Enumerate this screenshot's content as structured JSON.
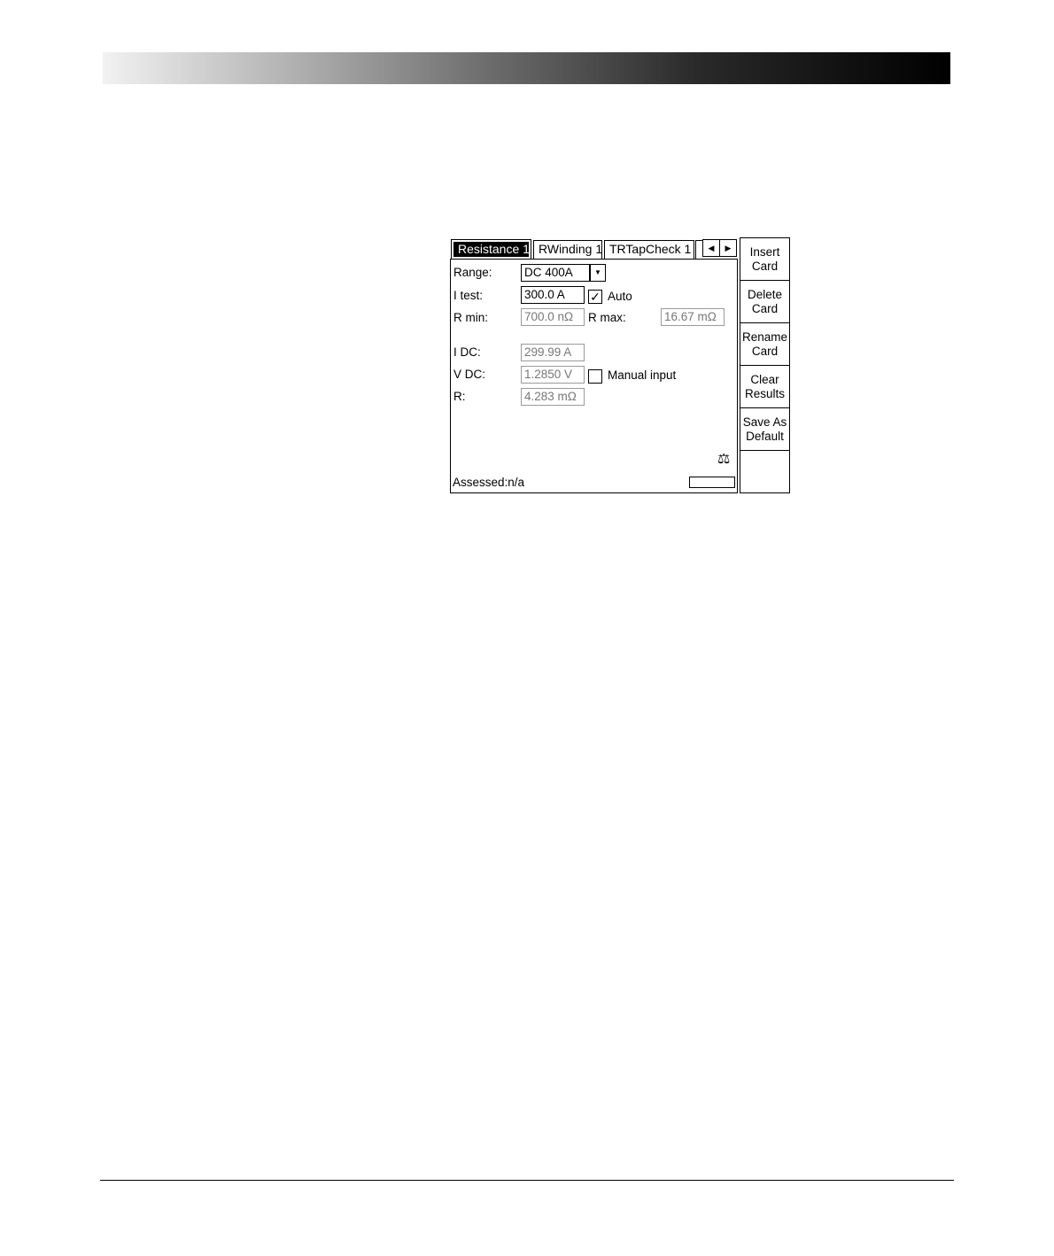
{
  "tabs": [
    {
      "label": "Resistance 1",
      "active": true
    },
    {
      "label": "RWinding 1",
      "active": false
    },
    {
      "label": "TRTapCheck 1",
      "active": false
    }
  ],
  "nav": {
    "prev_icon": "triangle-left-icon",
    "next_icon": "triangle-right-icon"
  },
  "form": {
    "range_label": "Range:",
    "range_value": "DC 400A",
    "itest_label": "I test:",
    "itest_value": "300.0 A",
    "auto_label": "Auto",
    "auto_checked": true,
    "rmin_label": "R min:",
    "rmin_value": "700.0 nΩ",
    "rmax_label": "R max:",
    "rmax_value": "16.67 mΩ"
  },
  "results": {
    "idc_label": "I DC:",
    "idc_value": "299.99 A",
    "vdc_label": "V DC:",
    "vdc_value": "1.2850 V",
    "manual_label": "Manual input",
    "manual_checked": false,
    "r_label": "R:",
    "r_value": "4.283 mΩ"
  },
  "status": {
    "assessed": "Assessed:n/a",
    "assess_icon": "scales-icon"
  },
  "softkeys": [
    {
      "line1": "Insert",
      "line2": "Card"
    },
    {
      "line1": "Delete",
      "line2": "Card"
    },
    {
      "line1": "Rename",
      "line2": "Card"
    },
    {
      "line1": "Clear",
      "line2": "Results"
    },
    {
      "line1": "Save As",
      "line2": "Default"
    },
    {
      "line1": "",
      "line2": ""
    }
  ]
}
